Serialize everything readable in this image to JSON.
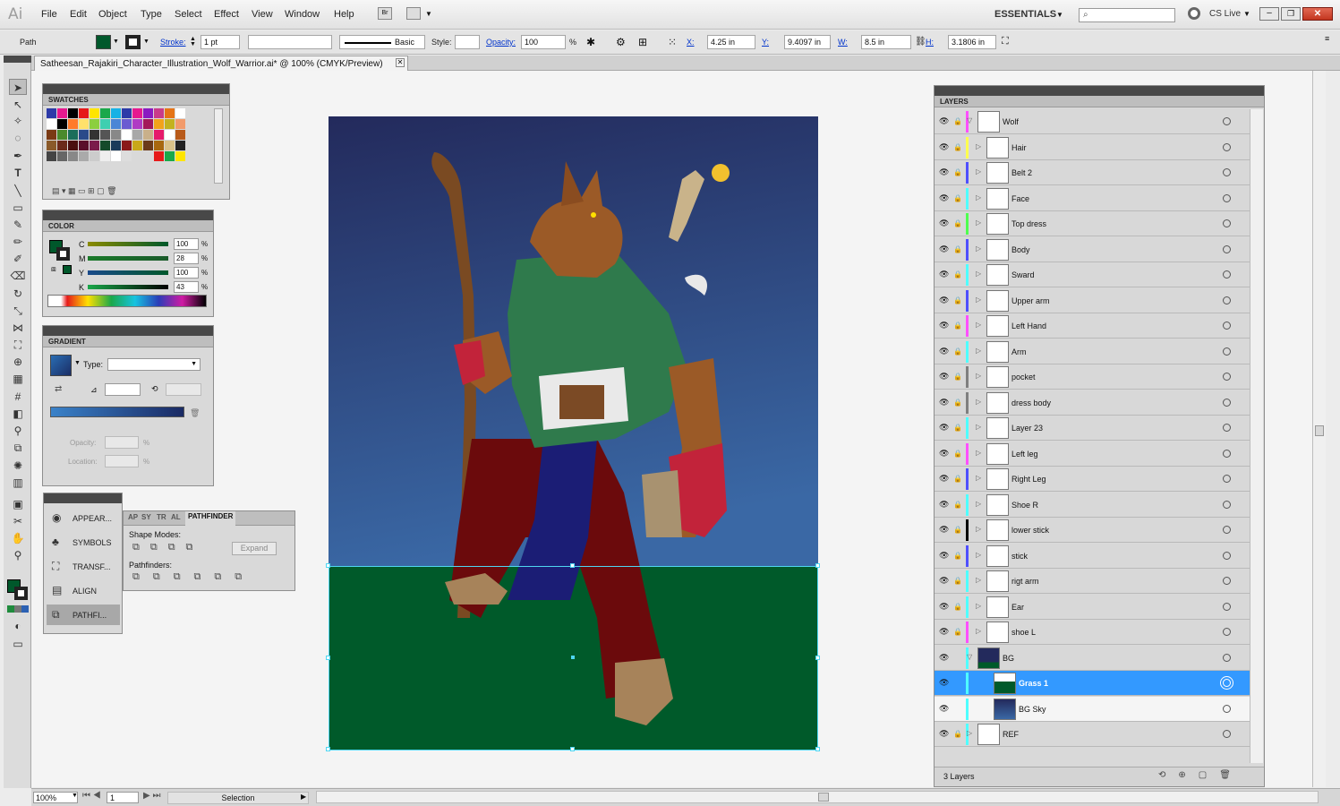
{
  "menu": {
    "logo": "Ai",
    "items": [
      "File",
      "Edit",
      "Object",
      "Type",
      "Select",
      "Effect",
      "View",
      "Window",
      "Help"
    ],
    "workspace": "ESSENTIALS",
    "cslive": "CS Live"
  },
  "control": {
    "object_type": "Path",
    "stroke_label": "Stroke:",
    "stroke_weight": "1 pt",
    "brush": "Basic",
    "style_label": "Style:",
    "opacity_label": "Opacity:",
    "opacity_value": "100",
    "percent": "%",
    "x_label": "X:",
    "x_value": "4.25 in",
    "y_label": "Y:",
    "y_value": "9.4097 in",
    "w_label": "W:",
    "w_value": "8.5 in",
    "h_label": "H:",
    "h_value": "3.1806 in"
  },
  "document": {
    "tab_title": "Satheesan_Rajakiri_Character_Illustration_Wolf_Warrior.ai* @ 100% (CMYK/Preview)"
  },
  "swatches": {
    "title": "SWATCHES"
  },
  "color": {
    "title": "COLOR",
    "channels": [
      {
        "label": "C",
        "value": "100"
      },
      {
        "label": "M",
        "value": "28"
      },
      {
        "label": "Y",
        "value": "100"
      },
      {
        "label": "K",
        "value": "43"
      }
    ],
    "percent": "%",
    "fill_color": "#00582b"
  },
  "gradient": {
    "title": "GRADIENT",
    "type_label": "Type:",
    "opacity_label": "Opacity:",
    "location_label": "Location:",
    "percent": "%"
  },
  "collapsed_panels": {
    "items": [
      {
        "label": "APPEAR...",
        "icon": "appearance-icon"
      },
      {
        "label": "SYMBOLS",
        "icon": "symbols-icon"
      },
      {
        "label": "TRANSF...",
        "icon": "transform-icon"
      },
      {
        "label": "ALIGN",
        "icon": "align-icon"
      },
      {
        "label": "PATHFI...",
        "icon": "pathfinder-icon"
      }
    ]
  },
  "pathfinder": {
    "tabs": [
      "AP",
      "SY",
      "TR",
      "AL",
      "PATHFINDER"
    ],
    "shape_modes": "Shape Modes:",
    "expand": "Expand",
    "pathfinders": "Pathfinders:"
  },
  "layers": {
    "title": "LAYERS",
    "footer": "3 Layers",
    "rows": [
      {
        "name": "Wolf",
        "indent": 0,
        "color": "#ff4fff",
        "expanded": true,
        "locked": true
      },
      {
        "name": "Hair",
        "indent": 1,
        "color": "#ffff4f",
        "expanded": false,
        "locked": true
      },
      {
        "name": "Belt 2",
        "indent": 1,
        "color": "#4f4fff",
        "expanded": false,
        "locked": true
      },
      {
        "name": "Face",
        "indent": 1,
        "color": "#4fffff",
        "expanded": false,
        "locked": true
      },
      {
        "name": "Top dress",
        "indent": 1,
        "color": "#4fff4f",
        "expanded": false,
        "locked": true
      },
      {
        "name": "Body",
        "indent": 1,
        "color": "#4f4fff",
        "expanded": false,
        "locked": true
      },
      {
        "name": "Sward",
        "indent": 1,
        "color": "#4fffff",
        "expanded": false,
        "locked": true
      },
      {
        "name": "Upper arm",
        "indent": 1,
        "color": "#4f4fff",
        "expanded": false,
        "locked": true
      },
      {
        "name": "Left Hand",
        "indent": 1,
        "color": "#ff4fff",
        "expanded": false,
        "locked": true
      },
      {
        "name": "Arm",
        "indent": 1,
        "color": "#4fffff",
        "expanded": false,
        "locked": true
      },
      {
        "name": "pocket",
        "indent": 1,
        "color": "#7f7f7f",
        "expanded": false,
        "locked": true
      },
      {
        "name": "dress body",
        "indent": 1,
        "color": "#7f7f7f",
        "expanded": false,
        "locked": true
      },
      {
        "name": "Layer 23",
        "indent": 1,
        "color": "#4fffff",
        "expanded": false,
        "locked": true
      },
      {
        "name": "Left leg",
        "indent": 1,
        "color": "#ff4fff",
        "expanded": false,
        "locked": true
      },
      {
        "name": "Right Leg",
        "indent": 1,
        "color": "#4f4fff",
        "expanded": false,
        "locked": true
      },
      {
        "name": "Shoe R",
        "indent": 1,
        "color": "#4fffff",
        "expanded": false,
        "locked": true
      },
      {
        "name": "lower stick",
        "indent": 1,
        "color": "#000000",
        "expanded": false,
        "locked": true
      },
      {
        "name": "stick",
        "indent": 1,
        "color": "#4f4fff",
        "expanded": false,
        "locked": true
      },
      {
        "name": "rigt arm",
        "indent": 1,
        "color": "#4fffff",
        "expanded": false,
        "locked": true
      },
      {
        "name": "Ear",
        "indent": 1,
        "color": "#4fffff",
        "expanded": false,
        "locked": true
      },
      {
        "name": "shoe L",
        "indent": 1,
        "color": "#ff4fff",
        "expanded": false,
        "locked": true
      },
      {
        "name": "BG",
        "indent": 0,
        "color": "#4fffff",
        "expanded": true,
        "locked": false
      },
      {
        "name": "Grass 1",
        "indent": 2,
        "color": "#4fffff",
        "expanded": false,
        "locked": false,
        "selected": true
      },
      {
        "name": "BG Sky",
        "indent": 2,
        "color": "#4fffff",
        "expanded": false,
        "locked": false
      },
      {
        "name": "REF",
        "indent": 0,
        "color": "#4fffff",
        "expanded": false,
        "locked": true
      }
    ]
  },
  "status": {
    "zoom": "100%",
    "page": "1",
    "tool": "Selection"
  },
  "colors": {
    "sky_top": "#232a5c",
    "sky_bottom": "#3a68a5",
    "grass": "#005a2a",
    "selection": "#3399ff"
  }
}
